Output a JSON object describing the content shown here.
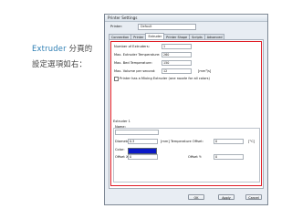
{
  "caption": {
    "line1_accent": "Extruder",
    "line1_rest": " 分頁的",
    "line2": "設定選項如右："
  },
  "window": {
    "title": "Printer Settings",
    "printer_label": "Printer:",
    "printer_value": "Default"
  },
  "tabs": [
    {
      "label": "Connection"
    },
    {
      "label": "Printer"
    },
    {
      "label": "Extruder",
      "active": true
    },
    {
      "label": "Printer Shape"
    },
    {
      "label": "Scripts"
    },
    {
      "label": "Advanced"
    }
  ],
  "extruder": {
    "num_extruders_label": "Number of Extruders:",
    "num_extruders_value": "1",
    "max_temp_label": "Max. Extruder Temperature:",
    "max_temp_value": "260",
    "max_bed_label": "Max. Bed Temperature:",
    "max_bed_value": "150",
    "max_volume_label": "Max. Volume per second:",
    "max_volume_value": "12",
    "max_volume_unit": "[mm³/s]",
    "mixing_label": "Printer has a Mixing Extruder (one nozzle for all colors)",
    "mixing_checked": false
  },
  "extruder1": {
    "group_title": "Extruder 1",
    "name_label": "Name:",
    "name_value": "",
    "diameter_label": "Diameter:",
    "diameter_value": "0.3",
    "temp_offset_label": "[mm] Temperature Offset:",
    "temp_offset_value": "0",
    "temp_offset_unit": "[°C]",
    "color_label": "Color:",
    "color_value": "#0a18c8",
    "offset_x_label": "Offset X:",
    "offset_x_value": "0",
    "offset_y_label": "Offset Y:",
    "offset_y_value": "0"
  },
  "buttons": {
    "ok": "OK",
    "apply": "Apply",
    "cancel": "Cancel"
  },
  "colors": {
    "highlight_border": "#e01b24",
    "caption_accent": "#2f7fb4"
  }
}
